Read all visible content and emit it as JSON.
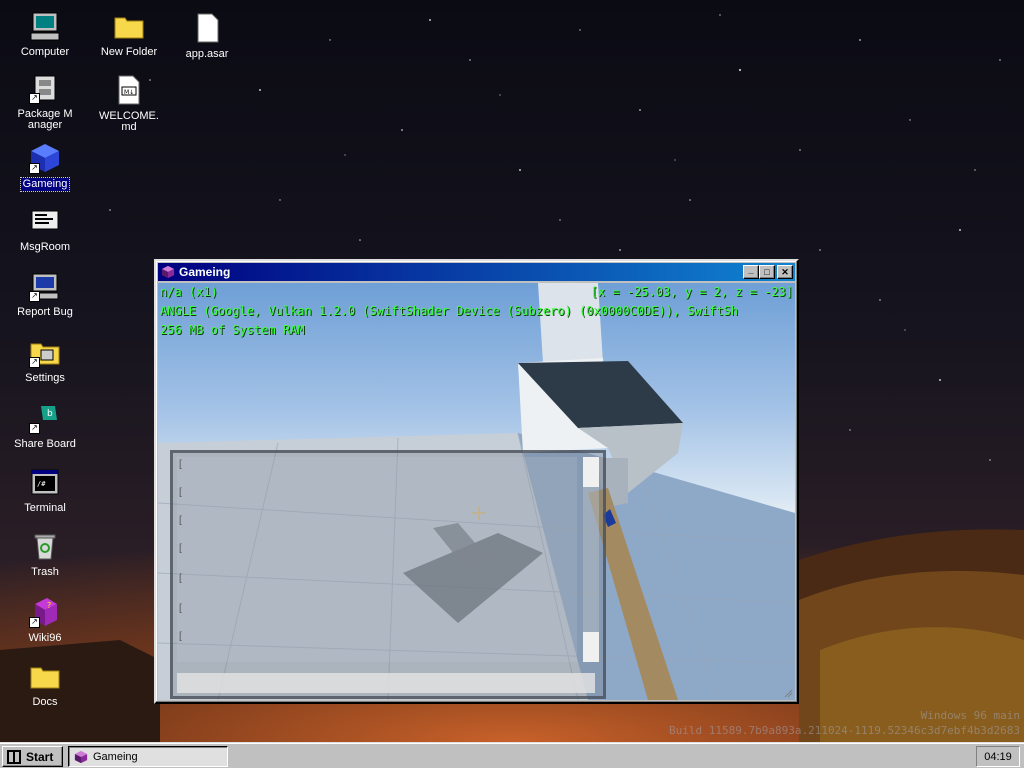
{
  "desktop": {
    "icons": [
      {
        "label": "Computer",
        "icon": "computer-icon"
      },
      {
        "label": "New Folder",
        "icon": "folder-icon"
      },
      {
        "label": "app.asar",
        "icon": "file-icon"
      },
      {
        "label": "Package Manager",
        "icon": "package-manager-icon"
      },
      {
        "label": "WELCOME.md",
        "icon": "markdown-file-icon"
      },
      {
        "label": "Gameing",
        "icon": "gameing-cube-icon"
      },
      {
        "label": "MsgRoom",
        "icon": "msgroom-icon"
      },
      {
        "label": "Report Bug",
        "icon": "report-bug-icon"
      },
      {
        "label": "Settings",
        "icon": "settings-icon"
      },
      {
        "label": "Share Board",
        "icon": "share-board-icon"
      },
      {
        "label": "Terminal",
        "icon": "terminal-icon"
      },
      {
        "label": "Trash",
        "icon": "trash-icon"
      },
      {
        "label": "Wiki96",
        "icon": "wiki-book-icon"
      },
      {
        "label": "Docs",
        "icon": "folder-icon"
      }
    ],
    "selected_icon": "Gameing",
    "watermark_line1": "Windows 96 main",
    "watermark_line2": "Build 11589.7b9a893a.211024-1119.52346c3d7ebf4b3d2683"
  },
  "window": {
    "title": "Gameing",
    "controls": {
      "minimize": "_",
      "maximize": "□",
      "close": "✕"
    },
    "hud": {
      "line1": "n/a (x1)",
      "coords": "[x = -25.03, y = 2, z = -23]",
      "line2": "ANGLE (Google, Vulkan 1.2.0 (SwiftShader Device (Subzero) (0x0000C0DE)), SwiftSh",
      "line3": "256 MB of System RAM"
    },
    "chat": {
      "line_markers": [
        "[",
        "[",
        "[",
        "[",
        "[",
        "[",
        "["
      ]
    }
  },
  "taskbar": {
    "start_label": "Start",
    "tasks": [
      {
        "label": "Gameing",
        "icon": "gameing-cube-icon"
      }
    ],
    "clock": "04:19"
  },
  "colors": {
    "titlebar_start": "#000080",
    "titlebar_end": "#1084d0",
    "hud_text": "#3cff3c",
    "chrome": "#c0c0c0"
  }
}
